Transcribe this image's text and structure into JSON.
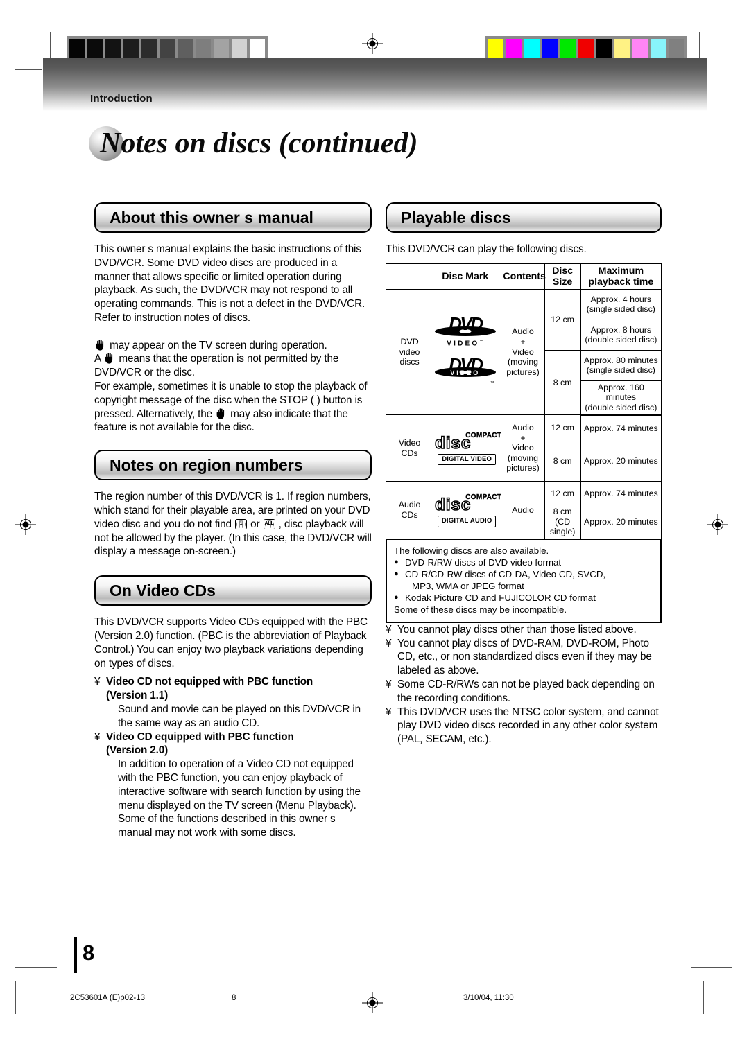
{
  "header": {
    "section_label": "Introduction"
  },
  "page": {
    "title": "Notes on discs (continued)",
    "number": "8"
  },
  "footer": {
    "file_code": "2C53601A (E)p02-13",
    "page_number": "8",
    "timestamp": "3/10/04, 11:30"
  },
  "left_column": {
    "section_about": {
      "heading": "About this owner s manual",
      "paragraph1": "This owner s manual explains the basic instructions of this DVD/VCR. Some DVD video discs are produced in a manner that allows specific or limited operation during playback. As such, the DVD/VCR may not respond to all operating commands. This is not a defect in the DVD/VCR. Refer to instruction notes of discs.",
      "para2_a": " may appear on the TV screen during operation.",
      "para2_b_pre": "A ",
      "para2_b_post": " means that the operation is not permitted by the DVD/VCR or the disc.",
      "para2_c_pre": "For example, sometimes it is unable to stop the playback of copyright message of the disc when the STOP ( ) button is pressed. Alternatively, the ",
      "para2_c_post": " may also indicate that the feature is not available for the disc."
    },
    "section_region": {
      "heading": "Notes on region numbers",
      "text_pre": "The region number of this DVD/VCR is 1. If region numbers, which stand for their playable area, are printed on your DVD video disc and you do not find ",
      "text_mid": " or ",
      "text_post": " , disc playback will not be allowed by the player. (In this case, the DVD/VCR will display a message on-screen.)",
      "icon_region_1_label": "1",
      "icon_region_all_label": "ALL"
    },
    "section_videocd": {
      "heading": "On Video CDs",
      "paragraph1": "This DVD/VCR supports Video CDs equipped with the PBC (Version 2.0) function. (PBC is the abbreviation of Playback Control.) You can enjoy two playback variations depending on types of discs.",
      "items": [
        {
          "marker": "¥",
          "title_line1": "Video CD not equipped with PBC function",
          "title_line2": "(Version 1.1)",
          "body": "Sound and movie can be played on this DVD/VCR in the same way as an audio CD."
        },
        {
          "marker": "¥",
          "title_line1": "Video CD equipped with PBC function",
          "title_line2": "(Version 2.0)",
          "body": "In addition to operation of a Video CD not equipped with the PBC function, you can enjoy playback of interactive software with search function by using the menu displayed on the TV screen (Menu Playback). Some of the functions described in this owner s manual may not work with some discs."
        }
      ]
    }
  },
  "right_column": {
    "section_playable": {
      "heading": "Playable discs",
      "intro": "This DVD/VCR can play the following discs.",
      "table": {
        "headers": [
          "",
          "Disc Mark",
          "Contents",
          "Disc Size",
          "Maximum playback time"
        ],
        "header_cells": {
          "blank": "",
          "disc_mark": "Disc Mark",
          "contents": "Contents",
          "disc_size_l1": "Disc",
          "disc_size_l2": "Size",
          "max_time_l1": "Maximum",
          "max_time_l2": "playback time"
        },
        "rows": [
          {
            "category_l1": "DVD",
            "category_l2": "video",
            "category_l3": "discs",
            "marks": [
              "DVD VIDEO",
              "DVD VIDEO"
            ],
            "contents_l1": "Audio",
            "contents_l2": "+",
            "contents_l3": "Video",
            "contents_l4": "(moving",
            "contents_l5": "pictures)",
            "sizes": [
              {
                "size": "12 cm",
                "times": [
                  {
                    "l1": "Approx. 4 hours",
                    "l2": "(single sided disc)"
                  },
                  {
                    "l1": "Approx. 8 hours",
                    "l2": "(double sided disc)"
                  }
                ]
              },
              {
                "size": "8 cm",
                "times": [
                  {
                    "l1": "Approx. 80 minutes",
                    "l2": "(single sided disc)"
                  },
                  {
                    "l1": "Approx. 160 minutes",
                    "l2": "(double sided disc)"
                  }
                ]
              }
            ]
          },
          {
            "category_l1": "Video",
            "category_l2": "CDs",
            "mark_word": "COMPACT",
            "mark_disc": "disc",
            "mark_bar": "DIGITAL VIDEO",
            "contents_l1": "Audio",
            "contents_l2": "+",
            "contents_l3": "Video",
            "contents_l4": "(moving",
            "contents_l5": "pictures)",
            "sizes": [
              {
                "size": "12 cm",
                "time": "Approx. 74 minutes"
              },
              {
                "size": "8 cm",
                "time": "Approx. 20 minutes"
              }
            ]
          },
          {
            "category_l1": "Audio",
            "category_l2": "CDs",
            "mark_word": "COMPACT",
            "mark_disc": "disc",
            "mark_bar": "DIGITAL AUDIO",
            "contents_l1": "Audio",
            "sizes": [
              {
                "size": "12 cm",
                "time": "Approx. 74 minutes"
              },
              {
                "size_l1": "8 cm",
                "size_l2": "(CD",
                "size_l3": "single)",
                "time": "Approx. 20 minutes"
              }
            ]
          }
        ]
      },
      "notebox": {
        "intro": "The following discs are also available.",
        "bullets": [
          {
            "line1": "DVD-R/RW discs of DVD video format"
          },
          {
            "line1": "CD-R/CD-RW discs of CD-DA, Video CD, SVCD,",
            "line2": "MP3, WMA or JPEG format"
          },
          {
            "line1": "Kodak Picture CD and FUJICOLOR CD format"
          }
        ],
        "outro": "Some of these discs may be incompatible."
      },
      "footnotes": [
        {
          "marker": "¥",
          "text": "You cannot play discs other than those listed above."
        },
        {
          "marker": "¥",
          "text": "You cannot play discs of DVD-RAM, DVD-ROM, Photo CD, etc., or non standardized discs even if they may be labeled as above."
        },
        {
          "marker": "¥",
          "text": "Some CD-R/RWs can not be played back depending on the recording conditions."
        },
        {
          "marker": "¥",
          "text": "This DVD/VCR uses the NTSC color system, and cannot play DVD video discs recorded in any other color system (PAL, SECAM, etc.)."
        }
      ]
    }
  },
  "print_marks": {
    "grayscale_bar": [
      "#050505",
      "#0b0b0b",
      "#131313",
      "#1d1d1d",
      "#2c2c2c",
      "#434343",
      "#5f5f5f",
      "#7e7e7e",
      "#a3a3a3",
      "#d2d2d2",
      "#ffffff"
    ],
    "color_bar": [
      "#ffff00",
      "#ff00ff",
      "#00ffff",
      "#0000ff",
      "#00e800",
      "#f00000",
      "#000000",
      "#fff284",
      "#ff85f5",
      "#88f4fb",
      "#808080"
    ]
  }
}
